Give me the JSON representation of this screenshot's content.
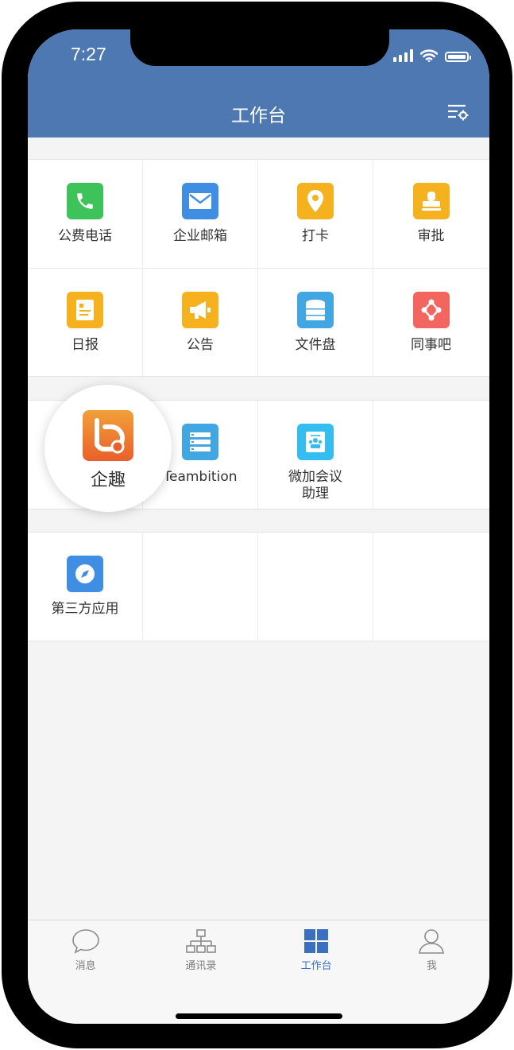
{
  "status_bar": {
    "time": "7:27"
  },
  "header": {
    "title": "工作台",
    "settings_icon": "settings-sliders-icon"
  },
  "colors": {
    "header": "#4d78b1",
    "active_tab": "#3b6fbf"
  },
  "section1": [
    {
      "label": "公费电话",
      "icon": "phone-icon",
      "color": "#3ec35b"
    },
    {
      "label": "企业邮箱",
      "icon": "mail-icon",
      "color": "#3f8ee4"
    },
    {
      "label": "打卡",
      "icon": "location-pin-icon",
      "color": "#f6b21e"
    },
    {
      "label": "审批",
      "icon": "stamp-icon",
      "color": "#f6b21e"
    },
    {
      "label": "日报",
      "icon": "report-icon",
      "color": "#f6b21e"
    },
    {
      "label": "公告",
      "icon": "megaphone-icon",
      "color": "#f6b21e"
    },
    {
      "label": "文件盘",
      "icon": "disk-icon",
      "color": "#41a6e2"
    },
    {
      "label": "同事吧",
      "icon": "network-icon",
      "color": "#f3655f"
    }
  ],
  "section2": [
    {
      "label": "企趣",
      "icon": "qiqu-icon"
    },
    {
      "label": "Teambition",
      "icon": "teambition-icon",
      "color": "#41a6e2"
    },
    {
      "label": "微加会议\n助理",
      "label_line1": "微加会议",
      "label_line2": "助理",
      "icon": "meeting-assistant-icon",
      "color": "#36bdf0"
    }
  ],
  "section3": [
    {
      "label": "第三方应用",
      "icon": "compass-icon",
      "color": "#3f8ee4"
    }
  ],
  "tabbar": [
    {
      "label": "消息",
      "icon": "chat-bubble-icon",
      "active": false
    },
    {
      "label": "通讯录",
      "icon": "org-chart-icon",
      "active": false
    },
    {
      "label": "工作台",
      "icon": "grid-icon",
      "active": true
    },
    {
      "label": "我",
      "icon": "person-icon",
      "active": false
    }
  ]
}
